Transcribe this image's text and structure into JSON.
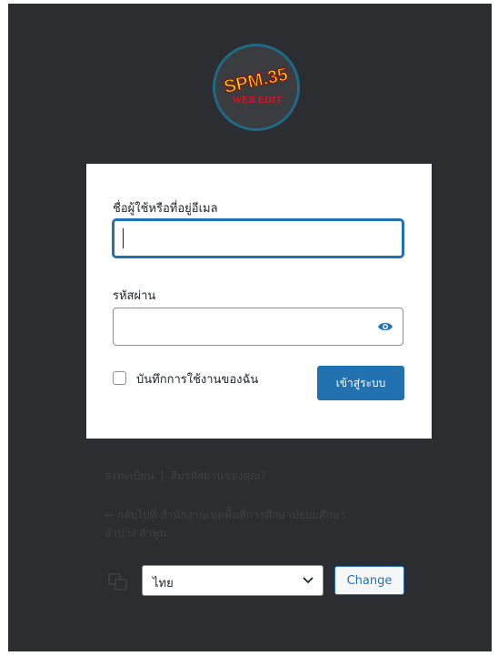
{
  "logo": {
    "line1": "SPM.35",
    "line2": "WEB EDIT"
  },
  "login_form": {
    "username_label": "ชื่อผู้ใช้หรือที่อยู่อีเมล",
    "username_value": "",
    "password_label": "รหัสผ่าน",
    "password_value": "",
    "remember_label": "บันทึกการใช้งานของฉัน",
    "submit_label": "เข้าสู่ระบบ"
  },
  "links": {
    "register": "ลงทะเบียน",
    "separator": "|",
    "lost_password": "ลืมรหัสผ่านของคุณ?",
    "back_to_site": "← กลับไปที่ สำนักงานเขตพื้นที่การศึกษามัธยมศึกษาลำปาง ลำพูน"
  },
  "language": {
    "selected": "ไทย",
    "change_label": "Change"
  },
  "colors": {
    "background": "#2c2d30",
    "primary": "#2271b1"
  },
  "icons": {
    "password_toggle": "eye-icon",
    "language": "translation-icon",
    "select": "chevron-down-icon"
  }
}
